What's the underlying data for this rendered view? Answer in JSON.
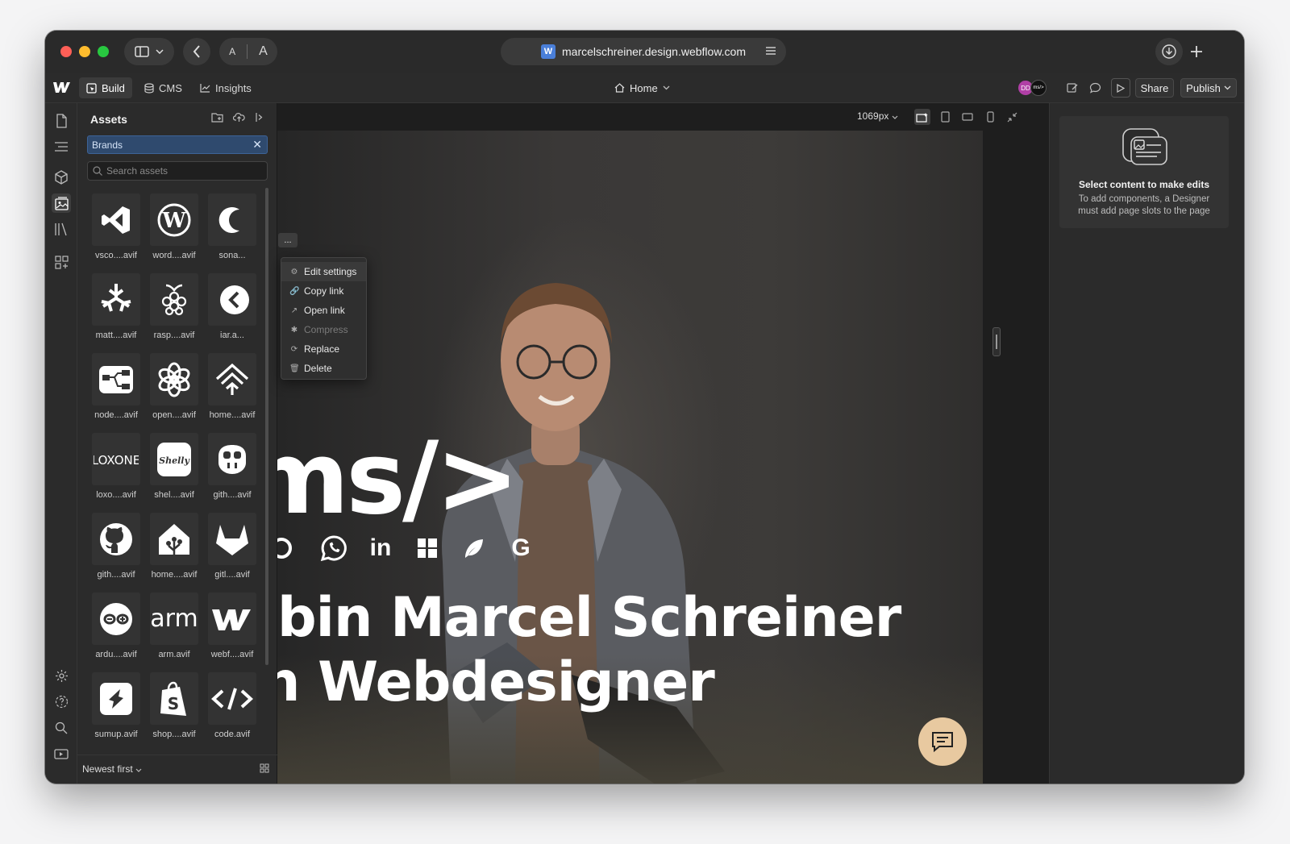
{
  "browser": {
    "url": "marcelschreiner.design.webflow.com",
    "font_small": "A",
    "font_large": "A"
  },
  "toolbar": {
    "tabs": [
      {
        "label": "Build"
      },
      {
        "label": "CMS"
      },
      {
        "label": "Insights"
      }
    ],
    "page": "Home",
    "avatar_initials": "DD",
    "avatar2_text": "ms/>",
    "share_label": "Share",
    "publish_label": "Publish"
  },
  "assets_panel": {
    "title": "Assets",
    "filter_chip": "Brands",
    "search_placeholder": "Search assets",
    "sort_label": "Newest first",
    "items": [
      {
        "label": "vsco....avif",
        "icon": "vscode-icon"
      },
      {
        "label": "word....avif",
        "icon": "wordpress-icon"
      },
      {
        "label": "sona...",
        "icon": "sonarr-icon"
      },
      {
        "label": "matt....avif",
        "icon": "matter-icon"
      },
      {
        "label": "rasp....avif",
        "icon": "raspberry-pi-icon"
      },
      {
        "label": "iar.a...",
        "icon": "iar-icon"
      },
      {
        "label": "node....avif",
        "icon": "node-red-icon"
      },
      {
        "label": "open....avif",
        "icon": "openai-icon"
      },
      {
        "label": "home....avif",
        "icon": "homebridge-icon"
      },
      {
        "label": "loxo....avif",
        "icon": "loxone-icon",
        "text": "LOXONE"
      },
      {
        "label": "shel....avif",
        "icon": "shelly-icon",
        "text": "Shelly"
      },
      {
        "label": "gith....avif",
        "icon": "github-copilot-icon"
      },
      {
        "label": "gith....avif",
        "icon": "github-icon"
      },
      {
        "label": "home....avif",
        "icon": "home-assistant-icon"
      },
      {
        "label": "gitl....avif",
        "icon": "gitlab-icon"
      },
      {
        "label": "ardu....avif",
        "icon": "arduino-icon"
      },
      {
        "label": "arm.avif",
        "icon": "arm-icon",
        "text": "arm"
      },
      {
        "label": "webf....avif",
        "icon": "webflow-icon"
      },
      {
        "label": "sumup.avif",
        "icon": "sumup-icon"
      },
      {
        "label": "shop....avif",
        "icon": "shopify-icon"
      },
      {
        "label": "code.avif",
        "icon": "code-icon",
        "text": "</>"
      }
    ]
  },
  "context_menu": {
    "items": [
      {
        "label": "Edit settings",
        "icon": "gear-icon",
        "state": "hover"
      },
      {
        "label": "Copy link",
        "icon": "link-icon"
      },
      {
        "label": "Open link",
        "icon": "external-link-icon"
      },
      {
        "label": "Compress",
        "icon": "compress-icon",
        "state": "disabled"
      },
      {
        "label": "Replace",
        "icon": "replace-icon"
      },
      {
        "label": "Delete",
        "icon": "trash-icon"
      }
    ],
    "more_label": "..."
  },
  "canvas": {
    "breakpoint": "1069px",
    "hero_mark": "ms/>",
    "hero_line1": "bin Marcel Schreiner",
    "hero_line2": "n Webdesigner",
    "social_in": "in",
    "social_g": "G"
  },
  "right_panel": {
    "title": "Select content to make edits",
    "description": "To add components, a Designer must add page slots to the page"
  },
  "colors": {
    "accent_blue": "#2f4a6e",
    "avatar": "#b03fa6",
    "chat_button": "#e8c9a0"
  }
}
